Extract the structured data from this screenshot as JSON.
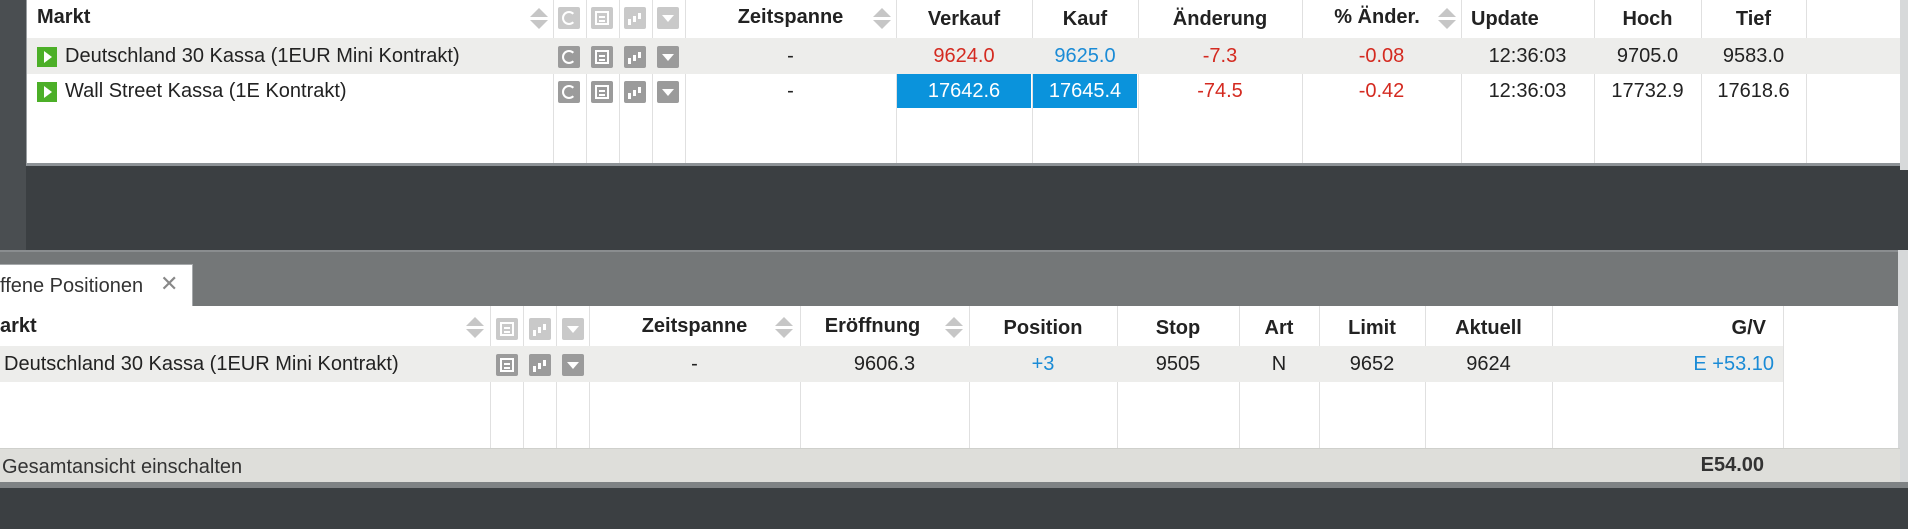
{
  "watchlist": {
    "headers": {
      "market": "Markt",
      "timespan": "Zeitspanne",
      "sell": "Verkauf",
      "buy": "Kauf",
      "change": "Änderung",
      "change_pct": "% Änder.",
      "update": "Update",
      "high": "Hoch",
      "low": "Tief"
    },
    "rows": [
      {
        "market": "Deutschland 30 Kassa (1EUR Mini Kontrakt)",
        "timespan": "-",
        "sell": "9624.0",
        "buy": "9625.0",
        "change": "-7.3",
        "change_pct": "-0.08",
        "update": "12:36:03",
        "high": "9705.0",
        "low": "9583.0"
      },
      {
        "market": "Wall Street Kassa (1E Kontrakt)",
        "timespan": "-",
        "sell": "17642.6",
        "buy": "17645.4",
        "change": "-74.5",
        "change_pct": "-0.42",
        "update": "12:36:03",
        "high": "17732.9",
        "low": "17618.6"
      }
    ]
  },
  "positions": {
    "tab_label": "ffene Positionen",
    "tab_close": "✕",
    "headers": {
      "market": "arkt",
      "timespan": "Zeitspanne",
      "opening": "Eröffnung",
      "position": "Position",
      "stop": "Stop",
      "type": "Art",
      "limit": "Limit",
      "current": "Aktuell",
      "pl": "G/V"
    },
    "rows": [
      {
        "market": "Deutschland 30 Kassa (1EUR Mini Kontrakt)",
        "timespan": "-",
        "opening": "9606.3",
        "position": "+3",
        "stop": "9505",
        "type": "N",
        "limit": "9652",
        "current": "9624",
        "pl": "E +53.10"
      }
    ],
    "footer": {
      "toggle_label": "Gesamtansicht einschalten",
      "total": "E54.00"
    }
  },
  "colors": {
    "negative": "#d42a20",
    "positive": "#1a8bd6",
    "highlight": "#0a93dc",
    "play": "#4caf28"
  },
  "icons": [
    "play-icon",
    "refresh-icon",
    "news-icon",
    "chart-icon",
    "dropdown-icon",
    "sort-icon",
    "close-icon"
  ]
}
